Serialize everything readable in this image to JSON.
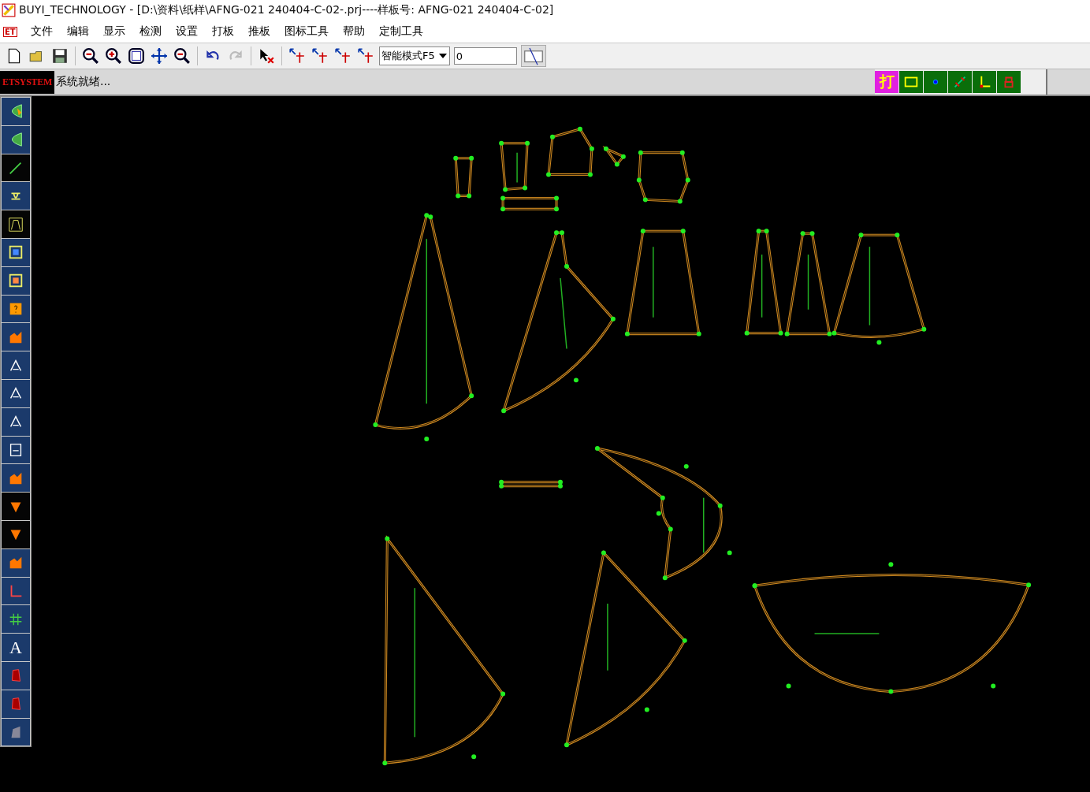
{
  "window": {
    "title": "BUYI_TECHNOLOGY - [D:\\资料\\纸样\\AFNG-021 240404-C-02-.prj----样板号: AFNG-021 240404-C-02]"
  },
  "app_icon": {
    "text": "ET"
  },
  "menu": [
    "文件",
    "编辑",
    "显示",
    "检测",
    "设置",
    "打板",
    "推板",
    "图标工具",
    "帮助",
    "定制工具"
  ],
  "toolbar": {
    "mode_select": {
      "value": "智能模式F5"
    },
    "number_field": {
      "value": "0"
    }
  },
  "status_bar": {
    "brand": "ETSYSTEM",
    "message": "系统就绪..."
  },
  "mode_buttons": [
    {
      "kind": "text",
      "label": "打",
      "selected": true
    },
    {
      "kind": "rect",
      "selected": false
    },
    {
      "kind": "dot",
      "selected": false
    },
    {
      "kind": "line",
      "selected": false
    },
    {
      "kind": "axes",
      "selected": false
    },
    {
      "kind": "glyph",
      "selected": false
    }
  ],
  "left_toolbar": {
    "text_tool_label": "A"
  }
}
